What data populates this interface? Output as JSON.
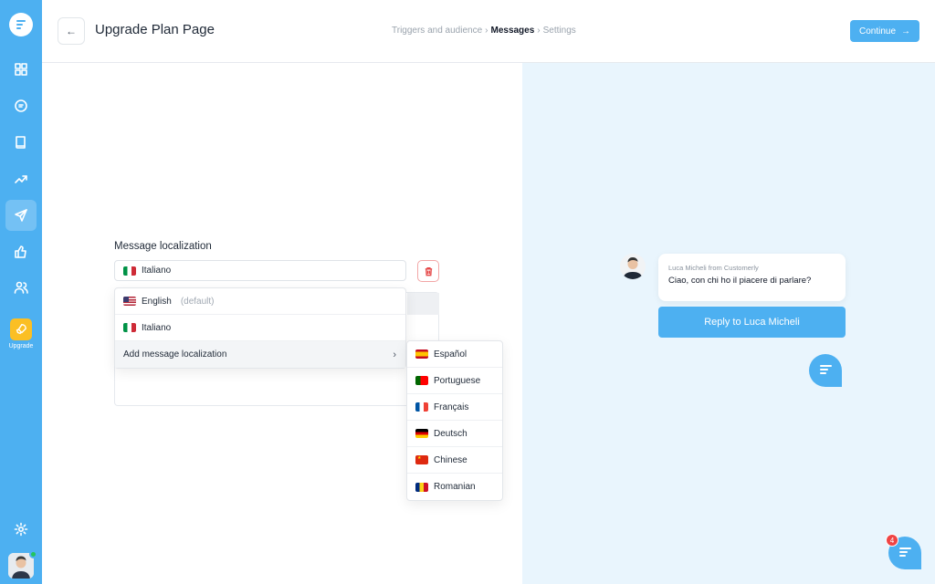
{
  "sidebar": {
    "upgrade_label": "Upgrade",
    "colors": {
      "bg": "#4db0f1",
      "upgrade": "#fbbf24",
      "online": "#22c55e"
    }
  },
  "header": {
    "title": "Upgrade Plan Page",
    "breadcrumbs": [
      "Triggers and audience",
      "Messages",
      "Settings"
    ],
    "breadcrumb_separator": "›",
    "continue_label": "Continue"
  },
  "form": {
    "label": "Message localization",
    "selected": "Italiano",
    "dropdown": {
      "english": "English",
      "english_note": "(default)",
      "italiano": "Italiano",
      "add": "Add message localization"
    },
    "languages": [
      "Español",
      "Portuguese",
      "Français",
      "Deutsch",
      "Chinese",
      "Romanian"
    ]
  },
  "preview": {
    "from": "Luca Micheli from Customerly",
    "message": "Ciao, con chi ho il piacere di parlare?",
    "reply_label": "Reply to Luca Micheli",
    "badge_count": "4"
  }
}
